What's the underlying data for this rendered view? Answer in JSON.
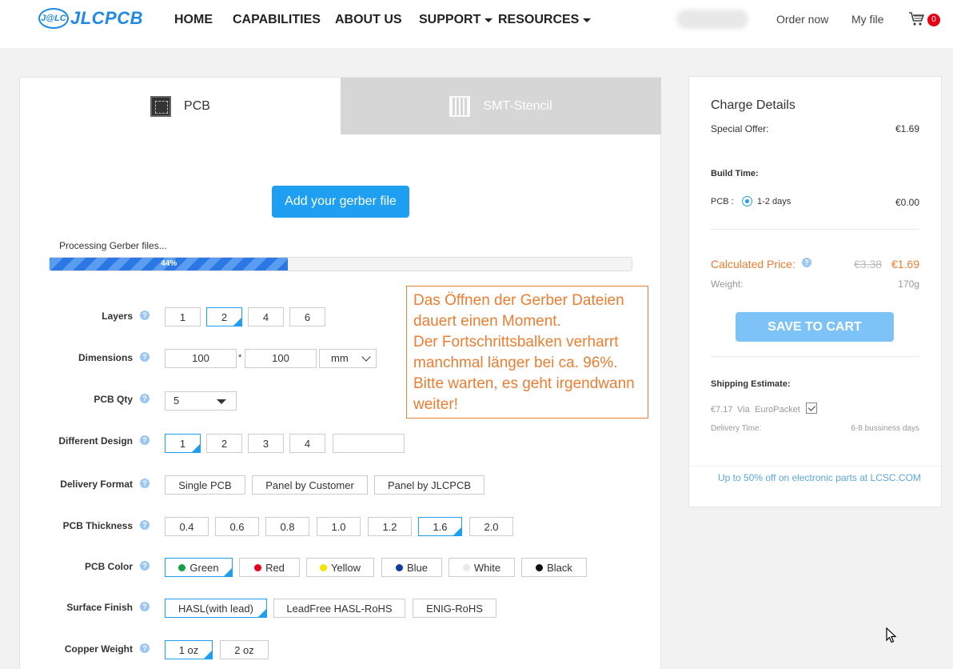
{
  "header": {
    "logo_mark": "J@LC",
    "logo_text": "JLCPCB",
    "nav": [
      {
        "label": "HOME"
      },
      {
        "label": "CAPABILITIES"
      },
      {
        "label": "ABOUT US"
      },
      {
        "label": "SUPPORT",
        "dropdown": true
      },
      {
        "label": "RESOURCES",
        "dropdown": true
      }
    ],
    "order_now": "Order now",
    "my_file": "My file",
    "cart_count": "0"
  },
  "tabs": {
    "pcb": "PCB",
    "smt": "SMT-Stencil"
  },
  "upload": {
    "button": "Add your gerber file",
    "status": "Processing Gerber files...",
    "progress_label": "44%",
    "progress_value": 0.41
  },
  "annotation": {
    "lines": [
      "Das Öffnen der Gerber Dateien",
      "dauert einen Moment.",
      "Der Fortschrittsbalken verharrt",
      "manchmal länger bei ca. 96%.",
      "Bitte warten, es geht irgendwann",
      "weiter!"
    ]
  },
  "form": {
    "layers": {
      "label": "Layers",
      "options": [
        "1",
        "2",
        "4",
        "6"
      ],
      "selected": "2"
    },
    "dimensions": {
      "label": "Dimensions",
      "x": "100",
      "sep": "*",
      "y": "100",
      "unit": "mm"
    },
    "qty": {
      "label": "PCB Qty",
      "value": "5"
    },
    "design": {
      "label": "Different Design",
      "options": [
        "1",
        "2",
        "3",
        "4"
      ],
      "selected": "1"
    },
    "delivery": {
      "label": "Delivery Format",
      "options": [
        "Single PCB",
        "Panel by Customer",
        "Panel by JLCPCB"
      ]
    },
    "thickness": {
      "label": "PCB Thickness",
      "options": [
        "0.4",
        "0.6",
        "0.8",
        "1.0",
        "1.2",
        "1.6",
        "2.0"
      ],
      "selected": "1.6"
    },
    "color": {
      "label": "PCB Color",
      "options": [
        {
          "name": "Green",
          "swatch": "#17a04a"
        },
        {
          "name": "Red",
          "swatch": "#e5001c"
        },
        {
          "name": "Yellow",
          "swatch": "#f2e300"
        },
        {
          "name": "Blue",
          "swatch": "#0d3f9c"
        },
        {
          "name": "White",
          "swatch": "#e9e9e9"
        },
        {
          "name": "Black",
          "swatch": "#111111"
        }
      ],
      "selected": "Green"
    },
    "surface": {
      "label": "Surface Finish",
      "options": [
        "HASL(with lead)",
        "LeadFree HASL-RoHS",
        "ENIG-RoHS"
      ],
      "selected": "HASL(with lead)"
    },
    "copper": {
      "label": "Copper Weight",
      "options": [
        "1 oz",
        "2 oz"
      ],
      "selected": "1 oz"
    }
  },
  "charges": {
    "title": "Charge Details",
    "special_offer_label": "Special Offer:",
    "special_offer_value": "€1.69",
    "build_time_label": "Build Time:",
    "pcb_label": "PCB :",
    "build_option": "1-2 days",
    "build_price": "€0.00",
    "calc_label": "Calculated Price:",
    "calc_old": "€3.38",
    "calc_new": "€1.69",
    "weight_label": "Weight:",
    "weight_value": "170g",
    "save_button": "SAVE TO CART",
    "shipping_label": "Shipping Estimate:",
    "shipping_price": "€7.17",
    "shipping_via": "Via",
    "shipping_carrier": "EuroPacket",
    "delivery_label": "Delivery Time:",
    "delivery_value": "6-8 bussiness days",
    "promo": "Up to 50% off on electronic parts at LCSC.COM"
  },
  "colors": {
    "accent": "#1e9ff2",
    "price_orange": "#ed7d31",
    "annotation_orange": "#ed7d31"
  }
}
